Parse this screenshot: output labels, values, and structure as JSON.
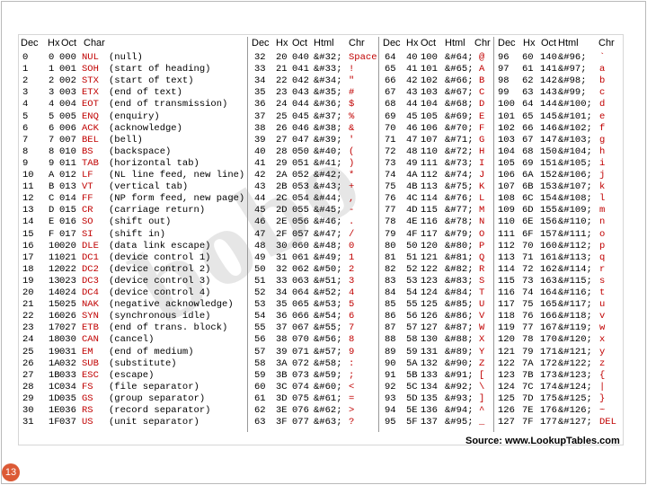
{
  "source": "Source: www.LookupTables.com",
  "slide_number": "13",
  "watermark": "bobo",
  "headers": [
    "Dec",
    "Hx",
    "Oct",
    "Char",
    "Dec",
    "Hx",
    "Oct",
    "Html",
    "Chr",
    "Dec",
    "Hx",
    "Oct",
    "Html",
    "Chr",
    "Dec",
    "Hx",
    "Oct",
    "Html",
    "Chr"
  ],
  "control_rows": [
    [
      "0",
      "0",
      "000",
      "NUL",
      "(null)"
    ],
    [
      "1",
      "1",
      "001",
      "SOH",
      "(start of heading)"
    ],
    [
      "2",
      "2",
      "002",
      "STX",
      "(start of text)"
    ],
    [
      "3",
      "3",
      "003",
      "ETX",
      "(end of text)"
    ],
    [
      "4",
      "4",
      "004",
      "EOT",
      "(end of transmission)"
    ],
    [
      "5",
      "5",
      "005",
      "ENQ",
      "(enquiry)"
    ],
    [
      "6",
      "6",
      "006",
      "ACK",
      "(acknowledge)"
    ],
    [
      "7",
      "7",
      "007",
      "BEL",
      "(bell)"
    ],
    [
      "8",
      "8",
      "010",
      "BS",
      "(backspace)"
    ],
    [
      "9",
      "9",
      "011",
      "TAB",
      "(horizontal tab)"
    ],
    [
      "10",
      "A",
      "012",
      "LF",
      "(NL line feed, new line)"
    ],
    [
      "11",
      "B",
      "013",
      "VT",
      "(vertical tab)"
    ],
    [
      "12",
      "C",
      "014",
      "FF",
      "(NP form feed, new page)"
    ],
    [
      "13",
      "D",
      "015",
      "CR",
      "(carriage return)"
    ],
    [
      "14",
      "E",
      "016",
      "SO",
      "(shift out)"
    ],
    [
      "15",
      "F",
      "017",
      "SI",
      "(shift in)"
    ],
    [
      "16",
      "10",
      "020",
      "DLE",
      "(data link escape)"
    ],
    [
      "17",
      "11",
      "021",
      "DC1",
      "(device control 1)"
    ],
    [
      "18",
      "12",
      "022",
      "DC2",
      "(device control 2)"
    ],
    [
      "19",
      "13",
      "023",
      "DC3",
      "(device control 3)"
    ],
    [
      "20",
      "14",
      "024",
      "DC4",
      "(device control 4)"
    ],
    [
      "21",
      "15",
      "025",
      "NAK",
      "(negative acknowledge)"
    ],
    [
      "22",
      "16",
      "026",
      "SYN",
      "(synchronous idle)"
    ],
    [
      "23",
      "17",
      "027",
      "ETB",
      "(end of trans. block)"
    ],
    [
      "24",
      "18",
      "030",
      "CAN",
      "(cancel)"
    ],
    [
      "25",
      "19",
      "031",
      "EM",
      "(end of medium)"
    ],
    [
      "26",
      "1A",
      "032",
      "SUB",
      "(substitute)"
    ],
    [
      "27",
      "1B",
      "033",
      "ESC",
      "(escape)"
    ],
    [
      "28",
      "1C",
      "034",
      "FS",
      "(file separator)"
    ],
    [
      "29",
      "1D",
      "035",
      "GS",
      "(group separator)"
    ],
    [
      "30",
      "1E",
      "036",
      "RS",
      "(record separator)"
    ],
    [
      "31",
      "1F",
      "037",
      "US",
      "(unit separator)"
    ]
  ],
  "group2": [
    [
      "32",
      "20",
      "040",
      "&#32;",
      "Space"
    ],
    [
      "33",
      "21",
      "041",
      "&#33;",
      "!"
    ],
    [
      "34",
      "22",
      "042",
      "&#34;",
      "\""
    ],
    [
      "35",
      "23",
      "043",
      "&#35;",
      "#"
    ],
    [
      "36",
      "24",
      "044",
      "&#36;",
      "$"
    ],
    [
      "37",
      "25",
      "045",
      "&#37;",
      "%"
    ],
    [
      "38",
      "26",
      "046",
      "&#38;",
      "&"
    ],
    [
      "39",
      "27",
      "047",
      "&#39;",
      "'"
    ],
    [
      "40",
      "28",
      "050",
      "&#40;",
      "("
    ],
    [
      "41",
      "29",
      "051",
      "&#41;",
      ")"
    ],
    [
      "42",
      "2A",
      "052",
      "&#42;",
      "*"
    ],
    [
      "43",
      "2B",
      "053",
      "&#43;",
      "+"
    ],
    [
      "44",
      "2C",
      "054",
      "&#44;",
      ","
    ],
    [
      "45",
      "2D",
      "055",
      "&#45;",
      "-"
    ],
    [
      "46",
      "2E",
      "056",
      "&#46;",
      "."
    ],
    [
      "47",
      "2F",
      "057",
      "&#47;",
      "/"
    ],
    [
      "48",
      "30",
      "060",
      "&#48;",
      "0"
    ],
    [
      "49",
      "31",
      "061",
      "&#49;",
      "1"
    ],
    [
      "50",
      "32",
      "062",
      "&#50;",
      "2"
    ],
    [
      "51",
      "33",
      "063",
      "&#51;",
      "3"
    ],
    [
      "52",
      "34",
      "064",
      "&#52;",
      "4"
    ],
    [
      "53",
      "35",
      "065",
      "&#53;",
      "5"
    ],
    [
      "54",
      "36",
      "066",
      "&#54;",
      "6"
    ],
    [
      "55",
      "37",
      "067",
      "&#55;",
      "7"
    ],
    [
      "56",
      "38",
      "070",
      "&#56;",
      "8"
    ],
    [
      "57",
      "39",
      "071",
      "&#57;",
      "9"
    ],
    [
      "58",
      "3A",
      "072",
      "&#58;",
      ":"
    ],
    [
      "59",
      "3B",
      "073",
      "&#59;",
      ";"
    ],
    [
      "60",
      "3C",
      "074",
      "&#60;",
      "<"
    ],
    [
      "61",
      "3D",
      "075",
      "&#61;",
      "="
    ],
    [
      "62",
      "3E",
      "076",
      "&#62;",
      ">"
    ],
    [
      "63",
      "3F",
      "077",
      "&#63;",
      "?"
    ]
  ],
  "group3": [
    [
      "64",
      "40",
      "100",
      "&#64;",
      "@"
    ],
    [
      "65",
      "41",
      "101",
      "&#65;",
      "A"
    ],
    [
      "66",
      "42",
      "102",
      "&#66;",
      "B"
    ],
    [
      "67",
      "43",
      "103",
      "&#67;",
      "C"
    ],
    [
      "68",
      "44",
      "104",
      "&#68;",
      "D"
    ],
    [
      "69",
      "45",
      "105",
      "&#69;",
      "E"
    ],
    [
      "70",
      "46",
      "106",
      "&#70;",
      "F"
    ],
    [
      "71",
      "47",
      "107",
      "&#71;",
      "G"
    ],
    [
      "72",
      "48",
      "110",
      "&#72;",
      "H"
    ],
    [
      "73",
      "49",
      "111",
      "&#73;",
      "I"
    ],
    [
      "74",
      "4A",
      "112",
      "&#74;",
      "J"
    ],
    [
      "75",
      "4B",
      "113",
      "&#75;",
      "K"
    ],
    [
      "76",
      "4C",
      "114",
      "&#76;",
      "L"
    ],
    [
      "77",
      "4D",
      "115",
      "&#77;",
      "M"
    ],
    [
      "78",
      "4E",
      "116",
      "&#78;",
      "N"
    ],
    [
      "79",
      "4F",
      "117",
      "&#79;",
      "O"
    ],
    [
      "80",
      "50",
      "120",
      "&#80;",
      "P"
    ],
    [
      "81",
      "51",
      "121",
      "&#81;",
      "Q"
    ],
    [
      "82",
      "52",
      "122",
      "&#82;",
      "R"
    ],
    [
      "83",
      "53",
      "123",
      "&#83;",
      "S"
    ],
    [
      "84",
      "54",
      "124",
      "&#84;",
      "T"
    ],
    [
      "85",
      "55",
      "125",
      "&#85;",
      "U"
    ],
    [
      "86",
      "56",
      "126",
      "&#86;",
      "V"
    ],
    [
      "87",
      "57",
      "127",
      "&#87;",
      "W"
    ],
    [
      "88",
      "58",
      "130",
      "&#88;",
      "X"
    ],
    [
      "89",
      "59",
      "131",
      "&#89;",
      "Y"
    ],
    [
      "90",
      "5A",
      "132",
      "&#90;",
      "Z"
    ],
    [
      "91",
      "5B",
      "133",
      "&#91;",
      "["
    ],
    [
      "92",
      "5C",
      "134",
      "&#92;",
      "\\"
    ],
    [
      "93",
      "5D",
      "135",
      "&#93;",
      "]"
    ],
    [
      "94",
      "5E",
      "136",
      "&#94;",
      "^"
    ],
    [
      "95",
      "5F",
      "137",
      "&#95;",
      "_"
    ]
  ],
  "group4": [
    [
      "96",
      "60",
      "140",
      "&#96;",
      "`"
    ],
    [
      "97",
      "61",
      "141",
      "&#97;",
      "a"
    ],
    [
      "98",
      "62",
      "142",
      "&#98;",
      "b"
    ],
    [
      "99",
      "63",
      "143",
      "&#99;",
      "c"
    ],
    [
      "100",
      "64",
      "144",
      "&#100;",
      "d"
    ],
    [
      "101",
      "65",
      "145",
      "&#101;",
      "e"
    ],
    [
      "102",
      "66",
      "146",
      "&#102;",
      "f"
    ],
    [
      "103",
      "67",
      "147",
      "&#103;",
      "g"
    ],
    [
      "104",
      "68",
      "150",
      "&#104;",
      "h"
    ],
    [
      "105",
      "69",
      "151",
      "&#105;",
      "i"
    ],
    [
      "106",
      "6A",
      "152",
      "&#106;",
      "j"
    ],
    [
      "107",
      "6B",
      "153",
      "&#107;",
      "k"
    ],
    [
      "108",
      "6C",
      "154",
      "&#108;",
      "l"
    ],
    [
      "109",
      "6D",
      "155",
      "&#109;",
      "m"
    ],
    [
      "110",
      "6E",
      "156",
      "&#110;",
      "n"
    ],
    [
      "111",
      "6F",
      "157",
      "&#111;",
      "o"
    ],
    [
      "112",
      "70",
      "160",
      "&#112;",
      "p"
    ],
    [
      "113",
      "71",
      "161",
      "&#113;",
      "q"
    ],
    [
      "114",
      "72",
      "162",
      "&#114;",
      "r"
    ],
    [
      "115",
      "73",
      "163",
      "&#115;",
      "s"
    ],
    [
      "116",
      "74",
      "164",
      "&#116;",
      "t"
    ],
    [
      "117",
      "75",
      "165",
      "&#117;",
      "u"
    ],
    [
      "118",
      "76",
      "166",
      "&#118;",
      "v"
    ],
    [
      "119",
      "77",
      "167",
      "&#119;",
      "w"
    ],
    [
      "120",
      "78",
      "170",
      "&#120;",
      "x"
    ],
    [
      "121",
      "79",
      "171",
      "&#121;",
      "y"
    ],
    [
      "122",
      "7A",
      "172",
      "&#122;",
      "z"
    ],
    [
      "123",
      "7B",
      "173",
      "&#123;",
      "{"
    ],
    [
      "124",
      "7C",
      "174",
      "&#124;",
      "|"
    ],
    [
      "125",
      "7D",
      "175",
      "&#125;",
      "}"
    ],
    [
      "126",
      "7E",
      "176",
      "&#126;",
      "~"
    ],
    [
      "127",
      "7F",
      "177",
      "&#127;",
      "DEL"
    ]
  ]
}
